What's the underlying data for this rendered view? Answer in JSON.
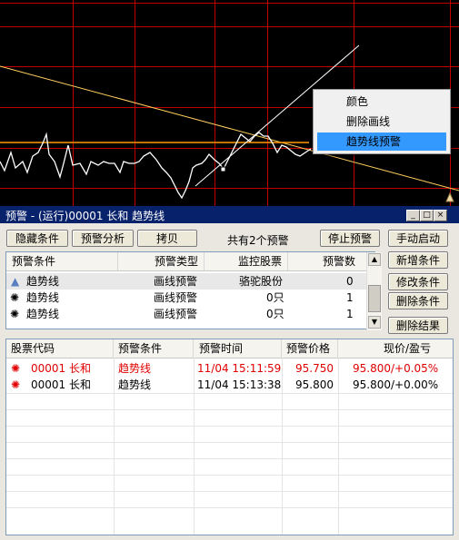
{
  "context_menu": {
    "items": [
      "颜色",
      "删除画线",
      "趋势线预警"
    ],
    "selected": 2
  },
  "window": {
    "title": "预警 - (运行)00001 长和 趋势线",
    "title_buttons": [
      "_",
      "□",
      "×"
    ]
  },
  "toolbar": {
    "hide_conditions": "隐藏条件",
    "alert_analysis": "预警分析",
    "copy": "拷贝",
    "summary": "共有2个预警",
    "stop_alert": "停止预警",
    "manual_start": "手动启动"
  },
  "side_buttons": {
    "add": "新增条件",
    "edit": "修改条件",
    "delete": "删除条件",
    "delete_results": "删除结果"
  },
  "conditions_table": {
    "headers": [
      "预警条件",
      "预警类型",
      "监控股票",
      "预警数"
    ],
    "rows": [
      {
        "icon": "warning-triangle-icon",
        "cond": "趋势线",
        "type": "画线预警",
        "stock": "骆驼股份",
        "count": "0",
        "selected": true
      },
      {
        "icon": "sun-alert-icon",
        "cond": "趋势线",
        "type": "画线预警",
        "stock": "0只",
        "count": "1",
        "selected": false
      },
      {
        "icon": "sun-alert-icon",
        "cond": "趋势线",
        "type": "画线预警",
        "stock": "0只",
        "count": "1",
        "selected": false
      }
    ]
  },
  "results_table": {
    "headers": [
      "股票代码",
      "预警条件",
      "预警时间",
      "预警价格",
      "现价/盈亏"
    ],
    "rows": [
      {
        "code": "00001 长和",
        "cond": "趋势线",
        "time": "11/04 15:11:59",
        "price": "95.750",
        "now": "95.800/+0.05%",
        "red": true
      },
      {
        "code": "00001 长和",
        "cond": "趋势线",
        "time": "11/04 15:13:38",
        "price": "95.800",
        "now": "95.800/+0.00%",
        "red": false
      }
    ]
  },
  "colors": {
    "grid": "#c00000",
    "price_line": "#ffffff",
    "trend_line": "#ffd060",
    "title_bar": "#08216b",
    "menu_select": "#3399ff"
  }
}
